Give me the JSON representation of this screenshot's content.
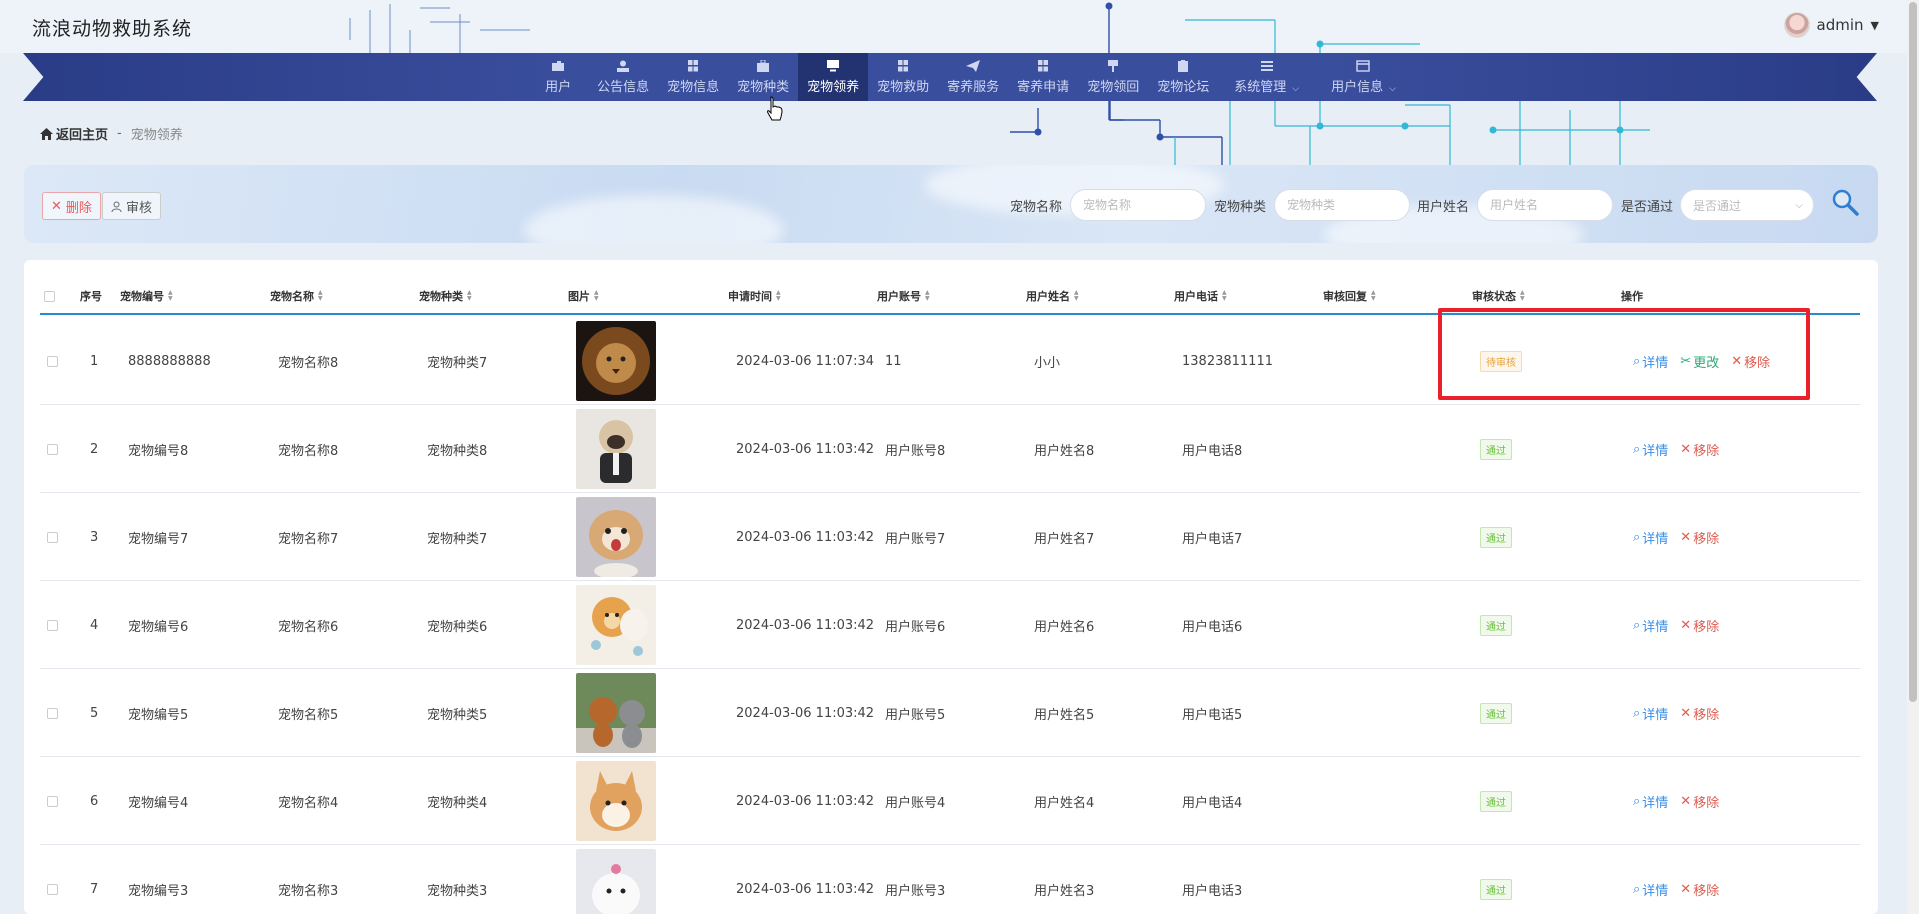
{
  "app": {
    "title": "流浪动物救助系统"
  },
  "user": {
    "name": "admin"
  },
  "nav": {
    "items": [
      {
        "label": "用户",
        "icon": "user-card-icon"
      },
      {
        "label": "公告信息",
        "icon": "person-icon"
      },
      {
        "label": "宠物信息",
        "icon": "grid-icon"
      },
      {
        "label": "宠物种类",
        "icon": "briefcase-icon"
      },
      {
        "label": "宠物领养",
        "icon": "monitor-icon",
        "active": true
      },
      {
        "label": "宠物救助",
        "icon": "grid-icon"
      },
      {
        "label": "寄养服务",
        "icon": "paper-plane-icon"
      },
      {
        "label": "寄养申请",
        "icon": "grid-icon"
      },
      {
        "label": "宠物领回",
        "icon": "pin-icon"
      },
      {
        "label": "宠物论坛",
        "icon": "clipboard-icon"
      },
      {
        "label": "系统管理",
        "icon": "menu-icon",
        "dropdown": true
      },
      {
        "label": "用户信息",
        "icon": "wallet-icon",
        "dropdown": true
      }
    ]
  },
  "breadcrumb": {
    "home": "返回主页",
    "separator": "-",
    "current": "宠物领养"
  },
  "filter": {
    "delete_label": "删除",
    "audit_label": "审核",
    "fields": [
      {
        "label": "宠物名称",
        "placeholder": "宠物名称"
      },
      {
        "label": "宠物种类",
        "placeholder": "宠物种类"
      },
      {
        "label": "用户姓名",
        "placeholder": "用户姓名"
      },
      {
        "label": "是否通过",
        "placeholder": "是否通过"
      }
    ]
  },
  "table": {
    "headers": [
      "序号",
      "宠物编号",
      "宠物名称",
      "宠物种类",
      "图片",
      "申请时间",
      "用户账号",
      "用户姓名",
      "用户电话",
      "审核回复",
      "审核状态",
      "操作"
    ],
    "actions": {
      "detail": "详情",
      "edit": "更改",
      "remove": "移除"
    },
    "rows": [
      {
        "index": "1",
        "pet_no": "8888888888",
        "pet_name": "宠物名称8",
        "pet_type": "宠物种类7",
        "time": "2024-03-06 11:07:34",
        "account": "11",
        "uname": "小小",
        "phone": "13823811111",
        "reply": "",
        "status": "待审核",
        "status_kind": "pending",
        "photo": "lion"
      },
      {
        "index": "2",
        "pet_no": "宠物编号8",
        "pet_name": "宠物名称8",
        "pet_type": "宠物种类8",
        "time": "2024-03-06 11:03:42",
        "account": "用户账号8",
        "uname": "用户姓名8",
        "phone": "用户电话8",
        "reply": "",
        "status": "通过",
        "status_kind": "pass",
        "photo": "pug"
      },
      {
        "index": "3",
        "pet_no": "宠物编号7",
        "pet_name": "宠物名称7",
        "pet_type": "宠物种类7",
        "time": "2024-03-06 11:03:42",
        "account": "用户账号7",
        "uname": "用户姓名7",
        "phone": "用户电话7",
        "reply": "",
        "status": "通过",
        "status_kind": "pass",
        "photo": "shih-tzu"
      },
      {
        "index": "4",
        "pet_no": "宠物编号6",
        "pet_name": "宠物名称6",
        "pet_type": "宠物种类6",
        "time": "2024-03-06 11:03:42",
        "account": "用户账号6",
        "uname": "用户姓名6",
        "phone": "用户电话6",
        "reply": "",
        "status": "通过",
        "status_kind": "pass",
        "photo": "pomeranian"
      },
      {
        "index": "5",
        "pet_no": "宠物编号5",
        "pet_name": "宠物名称5",
        "pet_type": "宠物种类5",
        "time": "2024-03-06 11:03:42",
        "account": "用户账号5",
        "uname": "用户姓名5",
        "phone": "用户电话5",
        "reply": "",
        "status": "通过",
        "status_kind": "pass",
        "photo": "poodles"
      },
      {
        "index": "6",
        "pet_no": "宠物编号4",
        "pet_name": "宠物名称4",
        "pet_type": "宠物种类4",
        "time": "2024-03-06 11:03:42",
        "account": "用户账号4",
        "uname": "用户姓名4",
        "phone": "用户电话4",
        "reply": "",
        "status": "通过",
        "status_kind": "pass",
        "photo": "corgi"
      },
      {
        "index": "7",
        "pet_no": "宠物编号3",
        "pet_name": "宠物名称3",
        "pet_type": "宠物种类3",
        "time": "2024-03-06 11:03:42",
        "account": "用户账号3",
        "uname": "用户姓名3",
        "phone": "用户电话3",
        "reply": "",
        "status": "通过",
        "status_kind": "pass",
        "photo": "white-dog"
      }
    ]
  },
  "colors": {
    "nav": "#3a4e9e",
    "nav_active": "#233270",
    "accent": "#2b89d0",
    "highlight": "#e8212b"
  }
}
